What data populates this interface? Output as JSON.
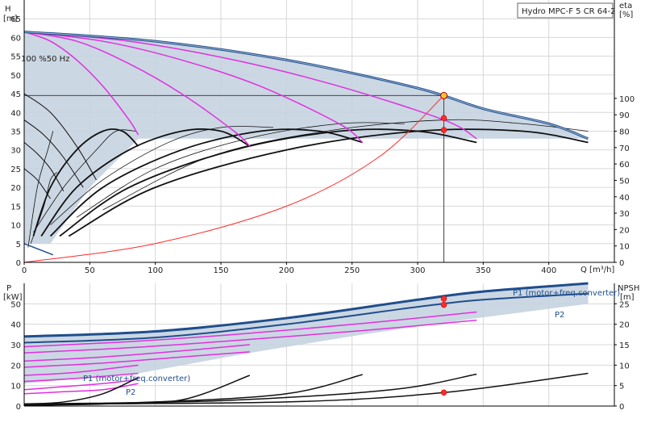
{
  "colors": {
    "band": "#c5d3e0",
    "blue": "#1f4e8c",
    "magenta": "#e030e0",
    "black": "#111111",
    "system": "#ff2a2a",
    "dutypoint": "#f4c430"
  },
  "chart_data": [
    {
      "type": "line",
      "title": "Hydro MPC-F 5 CR 64-2",
      "xlabel": "Q [m³/h]",
      "ylabel_left_unit": "H",
      "ylabel_left_sub": "[m]",
      "ylabel_right_unit": "eta",
      "ylabel_right_sub": "[%]",
      "annotation": "100 %50 Hz",
      "xlim": [
        0,
        450
      ],
      "ylim_left": [
        0,
        70
      ],
      "ylim_right": [
        0,
        160
      ],
      "xticks": [
        0,
        50,
        100,
        150,
        200,
        250,
        300,
        350,
        400
      ],
      "yticks_left": [
        0,
        5,
        10,
        15,
        20,
        25,
        30,
        35,
        40,
        45,
        50,
        55,
        60,
        65
      ],
      "yticks_right": [
        0,
        10,
        20,
        30,
        40,
        50,
        60,
        70,
        80,
        90,
        100
      ],
      "duty_point": {
        "q": 320,
        "h": 44.5
      },
      "eff_points": [
        {
          "q": 320,
          "h": 38.5
        },
        {
          "q": 320,
          "h": 35.3
        }
      ],
      "qh_max": [
        [
          0,
          61.5
        ],
        [
          100,
          59
        ],
        [
          200,
          54
        ],
        [
          300,
          46.5
        ],
        [
          350,
          41
        ],
        [
          400,
          37
        ],
        [
          430,
          33
        ]
      ],
      "qh_curves": [
        [
          [
            0,
            61.5
          ],
          [
            20,
            59
          ],
          [
            40,
            54
          ],
          [
            60,
            47
          ],
          [
            80,
            38
          ],
          [
            87,
            34
          ]
        ],
        [
          [
            0,
            61.5
          ],
          [
            40,
            59
          ],
          [
            80,
            53
          ],
          [
            120,
            45
          ],
          [
            160,
            35
          ],
          [
            172,
            31
          ]
        ],
        [
          [
            0,
            61.5
          ],
          [
            60,
            59
          ],
          [
            120,
            54
          ],
          [
            180,
            47
          ],
          [
            240,
            37
          ],
          [
            258,
            32
          ]
        ],
        [
          [
            0,
            61.5
          ],
          [
            80,
            59
          ],
          [
            160,
            54
          ],
          [
            240,
            47
          ],
          [
            320,
            38
          ],
          [
            345,
            33
          ]
        ]
      ],
      "qh_speed_curves": [
        [
          [
            0,
            45
          ],
          [
            20,
            40
          ],
          [
            40,
            31
          ],
          [
            55,
            22
          ]
        ],
        [
          [
            0,
            38
          ],
          [
            15,
            34
          ],
          [
            30,
            28
          ],
          [
            45,
            20
          ]
        ],
        [
          [
            0,
            32
          ],
          [
            10,
            29
          ],
          [
            20,
            25
          ],
          [
            30,
            19
          ]
        ],
        [
          [
            0,
            25
          ],
          [
            10,
            22
          ],
          [
            20,
            17
          ]
        ]
      ],
      "eff_curves": [
        [
          [
            7,
            7
          ],
          [
            20,
            20
          ],
          [
            40,
            30
          ],
          [
            60,
            35
          ],
          [
            75,
            35
          ],
          [
            87,
            31
          ]
        ],
        [
          [
            13,
            7
          ],
          [
            40,
            20
          ],
          [
            80,
            30
          ],
          [
            120,
            35
          ],
          [
            150,
            35
          ],
          [
            172,
            31
          ]
        ],
        [
          [
            20,
            7
          ],
          [
            60,
            20
          ],
          [
            120,
            30
          ],
          [
            180,
            35
          ],
          [
            225,
            35
          ],
          [
            258,
            32
          ]
        ],
        [
          [
            27,
            7
          ],
          [
            80,
            20
          ],
          [
            160,
            30
          ],
          [
            240,
            35
          ],
          [
            300,
            35
          ],
          [
            345,
            32
          ]
        ],
        [
          [
            34,
            7
          ],
          [
            100,
            20
          ],
          [
            200,
            30
          ],
          [
            300,
            35
          ],
          [
            380,
            35
          ],
          [
            430,
            32
          ]
        ]
      ],
      "eff_thin_curves": [
        [
          [
            3,
            4
          ],
          [
            10,
            20
          ],
          [
            18,
            30
          ],
          [
            22,
            35
          ]
        ],
        [
          [
            5,
            5
          ],
          [
            15,
            15
          ],
          [
            20,
            22
          ],
          [
            25,
            24
          ]
        ],
        [
          [
            7,
            8
          ],
          [
            30,
            20
          ],
          [
            55,
            30
          ],
          [
            70,
            35
          ],
          [
            85,
            35
          ]
        ],
        [
          [
            20,
            10
          ],
          [
            60,
            22
          ],
          [
            110,
            32
          ],
          [
            150,
            36
          ],
          [
            190,
            36
          ]
        ],
        [
          [
            40,
            12
          ],
          [
            100,
            25
          ],
          [
            170,
            33
          ],
          [
            240,
            37
          ],
          [
            290,
            37
          ]
        ],
        [
          [
            60,
            14
          ],
          [
            140,
            28
          ],
          [
            230,
            35
          ],
          [
            320,
            38
          ],
          [
            380,
            37
          ],
          [
            430,
            35
          ]
        ]
      ],
      "system_curve": [
        [
          0,
          0
        ],
        [
          100,
          5
        ],
        [
          200,
          15
        ],
        [
          270,
          28
        ],
        [
          320,
          44.5
        ]
      ],
      "band": [
        [
          0,
          61.5
        ],
        [
          100,
          59
        ],
        [
          200,
          54
        ],
        [
          300,
          46.5
        ],
        [
          350,
          41
        ],
        [
          400,
          37
        ],
        [
          430,
          33
        ],
        [
          430,
          33
        ],
        [
          350,
          33
        ],
        [
          258,
          33
        ],
        [
          172,
          33
        ],
        [
          87,
          33
        ],
        [
          50,
          20
        ],
        [
          20,
          5
        ],
        [
          0,
          5
        ]
      ]
    },
    {
      "type": "line",
      "ylabel_left_unit": "P",
      "ylabel_left_sub": "[kW]",
      "ylabel_right_unit": "NPSH",
      "ylabel_right_sub": "[m]",
      "xlim": [
        0,
        450
      ],
      "ylim_left": [
        0,
        60
      ],
      "ylim_right": [
        0,
        30
      ],
      "yticks_left": [
        0,
        10,
        20,
        30,
        40,
        50
      ],
      "yticks_right": [
        0,
        5,
        10,
        15,
        20,
        25
      ],
      "label_p1_top": "P1 (motor+freq.converter)",
      "label_p2_top": "P2",
      "label_p1_low": "P1 (motor+freq.converter)",
      "label_p2_low": "P2",
      "p1_max": [
        [
          0,
          34
        ],
        [
          100,
          36.5
        ],
        [
          200,
          43
        ],
        [
          300,
          52
        ],
        [
          350,
          56
        ],
        [
          430,
          60
        ]
      ],
      "p2_max": [
        [
          0,
          31
        ],
        [
          100,
          33.5
        ],
        [
          200,
          40
        ],
        [
          300,
          48.5
        ],
        [
          350,
          52
        ],
        [
          430,
          55
        ]
      ],
      "p_magenta": [
        [
          [
            0,
            29
          ],
          [
            80,
            31.5
          ],
          [
            160,
            35
          ],
          [
            260,
            40.5
          ],
          [
            345,
            46
          ]
        ],
        [
          [
            0,
            26
          ],
          [
            80,
            28.5
          ],
          [
            160,
            32
          ],
          [
            260,
            37
          ],
          [
            345,
            42
          ]
        ],
        [
          [
            0,
            22
          ],
          [
            60,
            24
          ],
          [
            120,
            27
          ],
          [
            172,
            30
          ]
        ],
        [
          [
            0,
            19
          ],
          [
            60,
            21
          ],
          [
            120,
            24
          ],
          [
            172,
            26.5
          ]
        ],
        [
          [
            0,
            15
          ],
          [
            40,
            16.5
          ],
          [
            87,
            20
          ]
        ],
        [
          [
            0,
            12
          ],
          [
            40,
            13.5
          ],
          [
            87,
            16
          ]
        ],
        [
          [
            0,
            8
          ],
          [
            30,
            9.5
          ],
          [
            60,
            11
          ],
          [
            87,
            13
          ]
        ],
        [
          [
            0,
            6
          ],
          [
            30,
            7
          ],
          [
            60,
            8
          ],
          [
            87,
            11
          ]
        ]
      ],
      "p_low_black": [
        [
          0,
          1
        ],
        [
          30,
          2
        ],
        [
          60,
          6
        ],
        [
          87,
          14
        ]
      ],
      "npsh_curves": [
        [
          [
            0,
            0.2
          ],
          [
            60,
            0.5
          ],
          [
            120,
            1.5
          ],
          [
            172,
            7.5
          ]
        ],
        [
          [
            0,
            0.3
          ],
          [
            100,
            1
          ],
          [
            200,
            3
          ],
          [
            258,
            7.7
          ]
        ],
        [
          [
            0,
            0.5
          ],
          [
            150,
            1.3
          ],
          [
            280,
            4
          ],
          [
            345,
            7.8
          ]
        ],
        [
          [
            0,
            0.5
          ],
          [
            200,
            1
          ],
          [
            320,
            3.3
          ],
          [
            430,
            8
          ]
        ]
      ],
      "points_p": [
        {
          "q": 320,
          "p": 52.5
        },
        {
          "q": 320,
          "p": 49.5
        }
      ],
      "point_npsh": {
        "q": 320,
        "n": 3.3
      }
    }
  ]
}
